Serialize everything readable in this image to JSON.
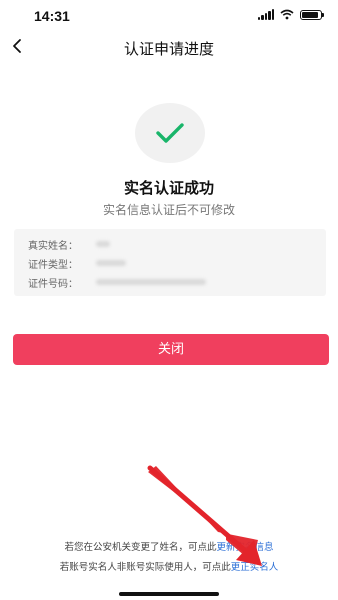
{
  "status_bar": {
    "time": "14:31"
  },
  "nav": {
    "title": "认证申请进度"
  },
  "result": {
    "title": "实名认证成功",
    "subtitle": "实名信息认证后不可修改"
  },
  "info": {
    "rows": [
      {
        "label": "真实姓名："
      },
      {
        "label": "证件类型："
      },
      {
        "label": "证件号码："
      }
    ]
  },
  "actions": {
    "close_label": "关闭"
  },
  "footer": {
    "line1_text": "若您在公安机关变更了姓名，可点此",
    "line1_link": "更新实名信息",
    "line2_text": "若账号实名人非账号实际使用人，可点此",
    "line2_link": "更正实名人"
  },
  "colors": {
    "accent": "#f03f5e",
    "check": "#19b56a",
    "link": "#2c6fd6",
    "annotation_arrow": "#e3242b"
  }
}
